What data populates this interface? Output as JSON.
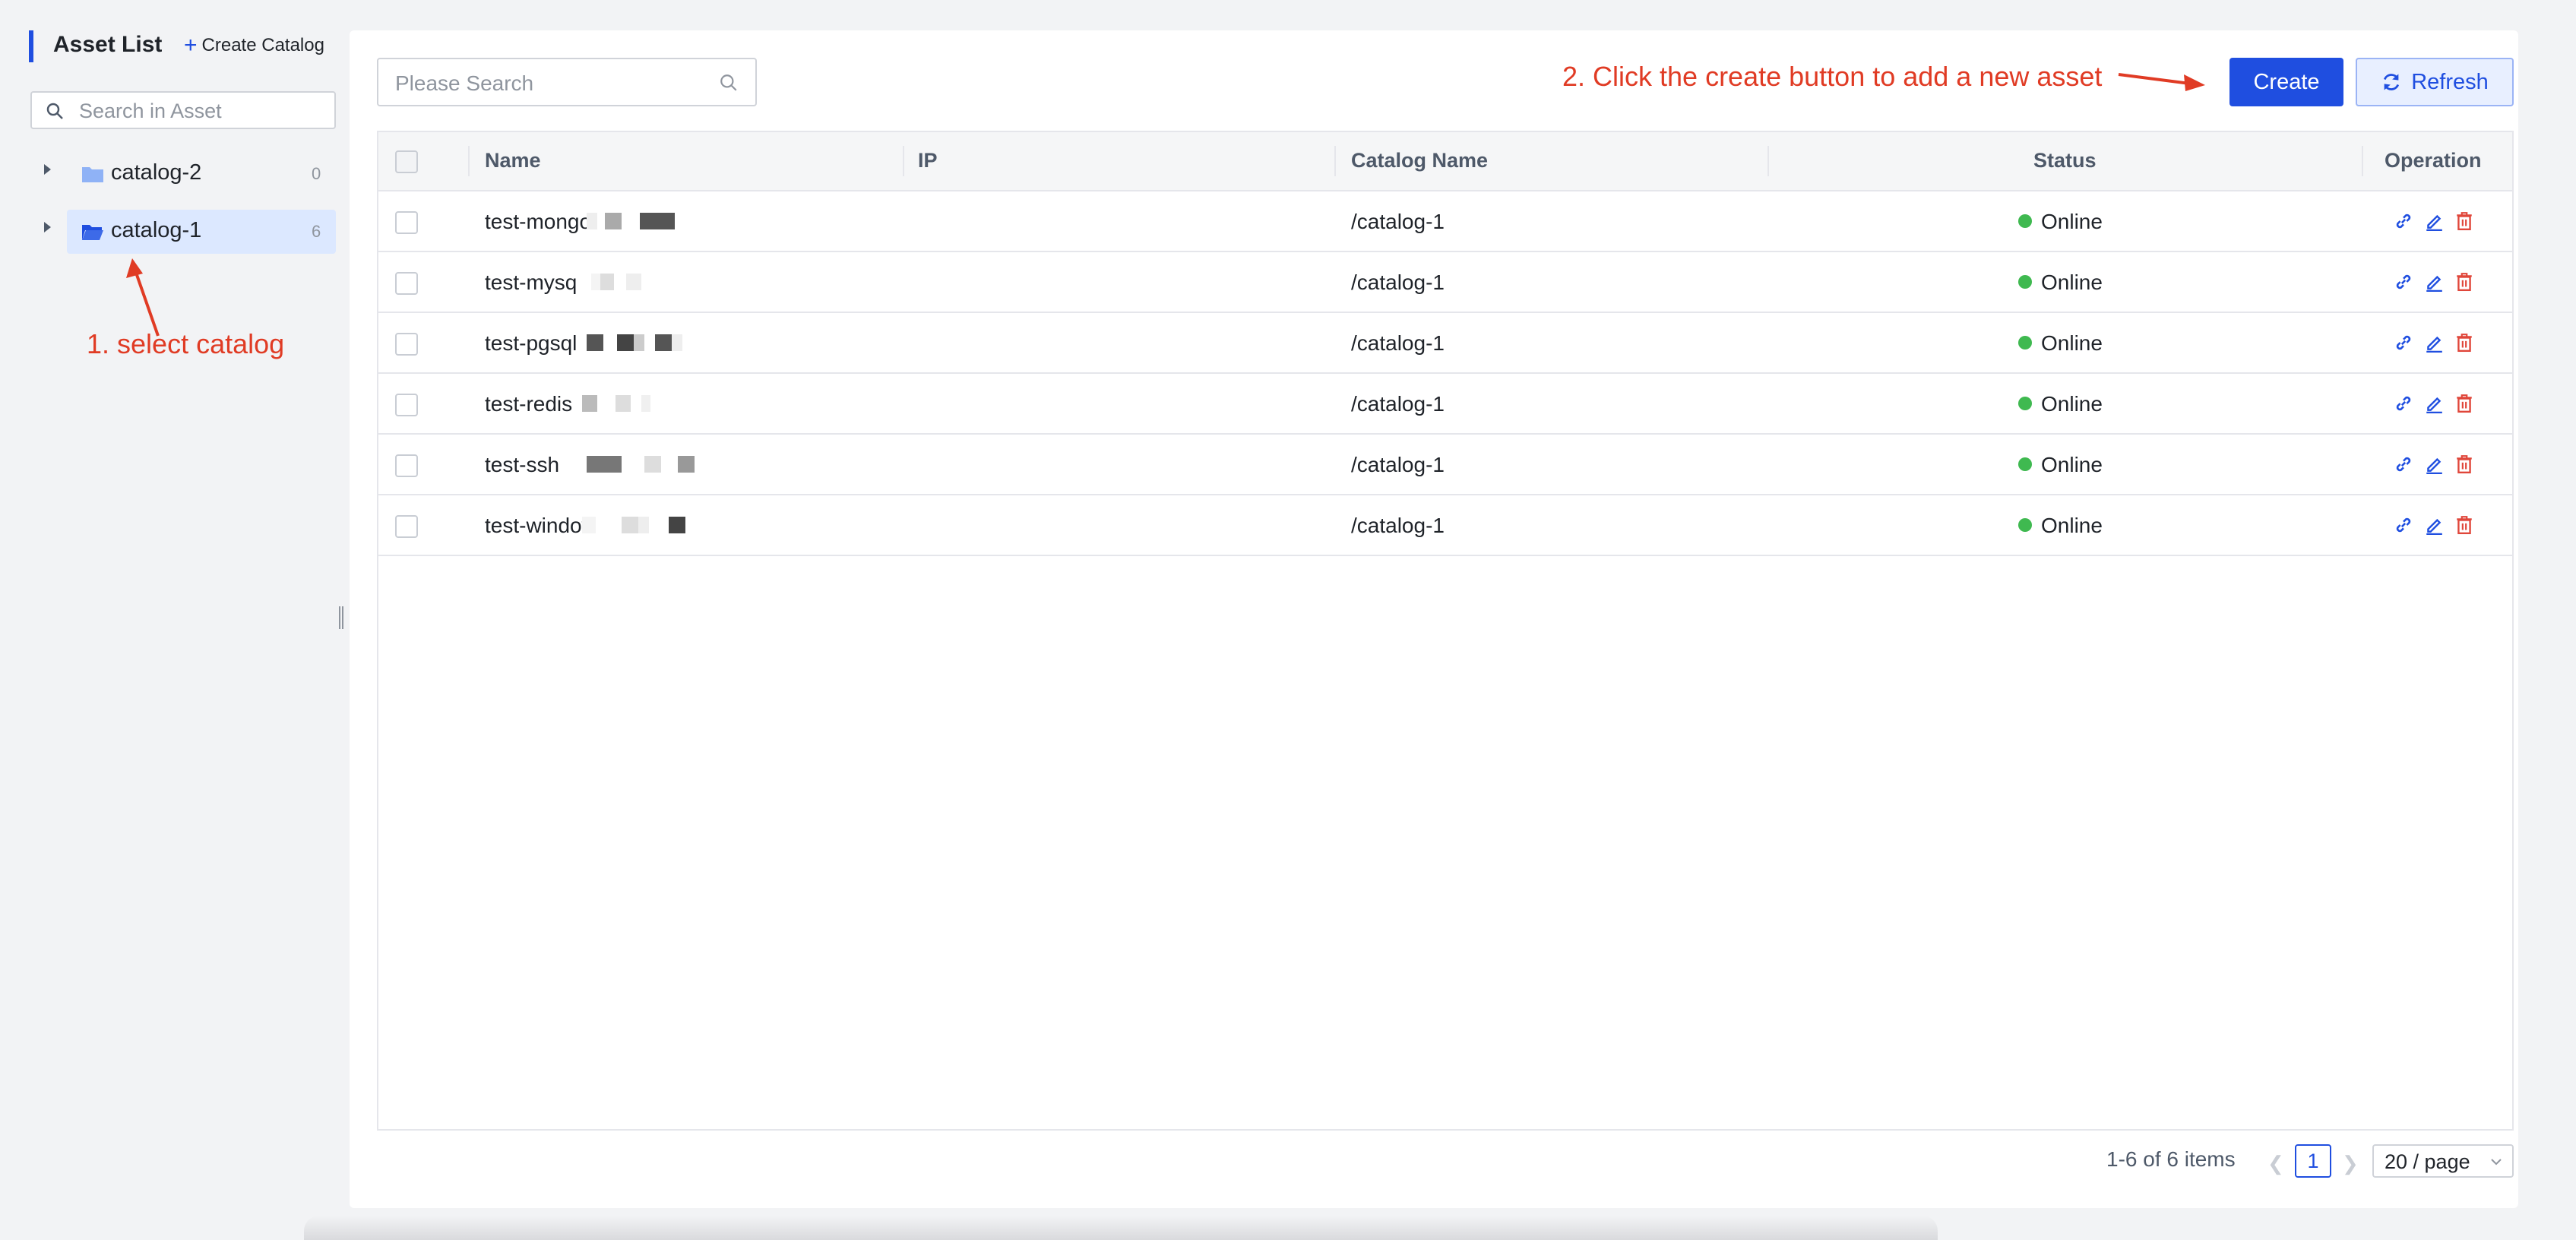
{
  "sidebar": {
    "title": "Asset List",
    "create_catalog": "Create Catalog",
    "search_placeholder": "Search in Asset",
    "tree": [
      {
        "label": "catalog-2",
        "count": "0",
        "selected": false
      },
      {
        "label": "catalog-1",
        "count": "6",
        "selected": true
      }
    ]
  },
  "annotations": {
    "step1": "1. select catalog",
    "step2": "2. Click the create button to add a new asset",
    "color": "#e03b24"
  },
  "toolbar": {
    "search_placeholder": "Please Search",
    "create_label": "Create",
    "refresh_label": "Refresh"
  },
  "table": {
    "columns": [
      "Name",
      "IP",
      "Catalog Name",
      "Status",
      "Operation"
    ],
    "rows": [
      {
        "name": "test-mongodb",
        "catalog": "/catalog-1",
        "status": "Online"
      },
      {
        "name": "test-mysql",
        "catalog": "/catalog-1",
        "status": "Online"
      },
      {
        "name": "test-pgsql",
        "catalog": "/catalog-1",
        "status": "Online"
      },
      {
        "name": "test-redis",
        "catalog": "/catalog-1",
        "status": "Online"
      },
      {
        "name": "test-ssh",
        "catalog": "/catalog-1",
        "status": "Online"
      },
      {
        "name": "test-windows",
        "catalog": "/catalog-1",
        "status": "Online"
      }
    ],
    "operation_icons": [
      "link-icon",
      "edit-icon",
      "delete-icon"
    ]
  },
  "pagination": {
    "total_text": "1-6 of 6 items",
    "current_page": "1",
    "page_size": "20 / page"
  },
  "colors": {
    "accent": "#1f4ee0",
    "online": "#3fb950",
    "delete": "#e0463a",
    "annotation": "#e03b24"
  }
}
